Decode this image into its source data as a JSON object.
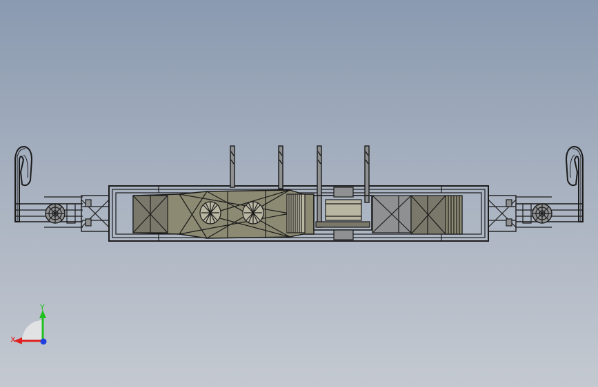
{
  "viewport": {
    "background_top": "#8a9ab0",
    "background_bottom": "#c4c9d1"
  },
  "model": {
    "line_color": "#1b1b1b",
    "fill_body": "#8c8a72",
    "fill_dark": "#7a786a",
    "fill_light": "#b9b6a2",
    "fill_grey": "#8f9092"
  },
  "triad": {
    "x_label": "X",
    "y_label": "Y",
    "x_color": "#e02020",
    "y_color": "#20c020",
    "z_color": "#2040e0"
  }
}
